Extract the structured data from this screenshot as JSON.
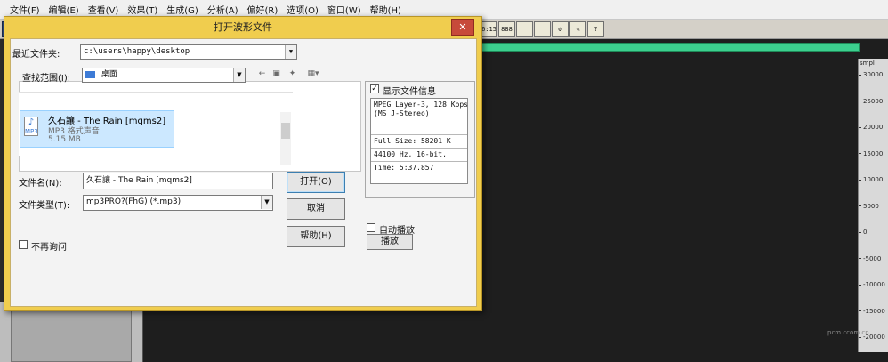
{
  "menu": [
    "文件(F)",
    "编辑(E)",
    "查看(V)",
    "效果(T)",
    "生成(G)",
    "分析(A)",
    "偏好(R)",
    "选项(O)",
    "窗口(W)",
    "帮助(H)"
  ],
  "toolbar": {
    "icons": [
      "6:15",
      "888",
      "",
      "",
      "",
      ""
    ]
  },
  "dialog": {
    "title": "打开波形文件",
    "close_label": "✕",
    "recent_folder_label": "最近文件夹:",
    "recent_folder_value": "c:\\users\\happy\\desktop",
    "lookin_label": "查找范围(I):",
    "lookin_value": "桌面",
    "file": {
      "name": "久石讓 - The Rain [mqms2]",
      "type": "MP3 格式声音",
      "size": "5.15 MB"
    },
    "filename_label": "文件名(N):",
    "filename_value": "久石讓 - The Rain [mqms2]",
    "filetype_label": "文件类型(T):",
    "filetype_value": "mp3PRO?(FhG) (*.mp3)",
    "open_button": "打开(O)",
    "cancel_button": "取消",
    "help_button": "帮助(H)",
    "dont_ask_label": "不再询问",
    "show_info_label": "显示文件信息",
    "show_info_checked": true,
    "info_lines": [
      "MPEG Layer-3, 128 Kbps",
      "(MS J-Stereo)",
      "Full Size: 58201 K",
      "44100 Hz, 16-bit,",
      "Time:   5:37.857"
    ],
    "autoplay_label": "自动播放",
    "play_button": "播放"
  },
  "ruler": {
    "unit": "smpl",
    "ticks": [
      "30000",
      "25000",
      "20000",
      "15000",
      "10000",
      "5000",
      "0",
      "-5000",
      "-10000",
      "-15000",
      "-20000"
    ]
  },
  "watermark": "pcm.ccom.cn",
  "colors": {
    "dialog_frame": "#f0cd4e",
    "overview_bar": "#3ccf8e",
    "close_button": "#c74a3a",
    "selection": "#cce8ff"
  }
}
